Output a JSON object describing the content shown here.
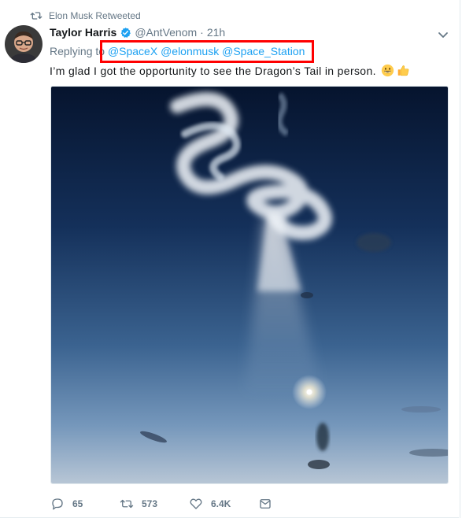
{
  "retweet_context": {
    "label": "Elon Musk Retweeted",
    "icon": "retweet-icon"
  },
  "author": {
    "fullname": "Taylor Harris",
    "username": "@AntVenom",
    "separator": "·",
    "time": "21h",
    "verified_icon": "verified-badge-icon",
    "avatar": "avatar"
  },
  "reply_context": {
    "prefix": "Replying to",
    "mentions": [
      "@SpaceX",
      "@elonmusk",
      "@Space_Station"
    ]
  },
  "tweet": {
    "text": "I’m glad I got the opportunity to see the Dragon’s Tail in person.",
    "emojis": [
      "grinning-face-icon",
      "thumbs-up-icon"
    ]
  },
  "actions": {
    "reply_count": "65",
    "retweet_count": "573",
    "like_count": "6.4K"
  },
  "colors": {
    "link": "#1da1f2",
    "secondary_text": "#657786",
    "primary_text": "#14171a",
    "highlight": "#ff0000"
  }
}
